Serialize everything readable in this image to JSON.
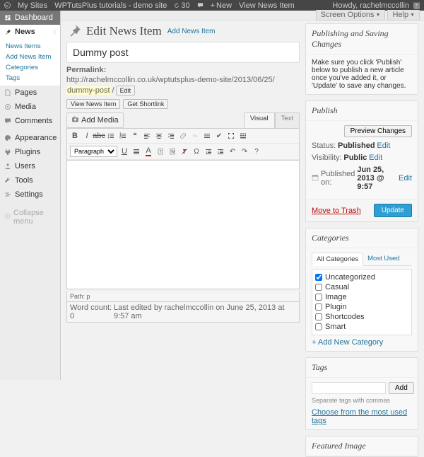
{
  "topbar": {
    "mysites": "My Sites",
    "sitename": "WPTutsPlus tutorials - demo site",
    "comments": "30",
    "new": "New",
    "view": "View News Item",
    "howdy": "Howdy, rachelmccollin"
  },
  "screenopts": {
    "screen": "Screen Options",
    "help": "Help"
  },
  "sidebar": {
    "dashboard": "Dashboard",
    "news": "News",
    "sub": {
      "items": "News Items",
      "add": "Add News Item",
      "cats": "Categories",
      "tags": "Tags"
    },
    "pages": "Pages",
    "media": "Media",
    "comments": "Comments",
    "appearance": "Appearance",
    "plugins": "Plugins",
    "users": "Users",
    "tools": "Tools",
    "settings": "Settings",
    "collapse": "Collapse menu"
  },
  "header": {
    "title": "Edit News Item",
    "add": "Add News Item"
  },
  "post": {
    "title": "Dummy post",
    "permalink_label": "Permalink:",
    "permalink_base": "http://rachelmccollin.co.uk/wptutsplus-demo-site/2013/06/25/",
    "permalink_slug": "dummy-post",
    "permalink_end": "/",
    "edit": "Edit",
    "view": "View News Item",
    "shortlink": "Get Shortlink",
    "addmedia": "Add Media",
    "visual": "Visual",
    "text": "Text",
    "paragraph": "Paragraph",
    "path": "Path: p",
    "wordcount": "Word count: 0",
    "lastedit": "Last edited by rachelmccollin on June 25, 2013 at 9:57 am"
  },
  "pubsave": {
    "title": "Publishing and Saving Changes",
    "msg": "Make sure you click 'Publish' below to publish a new article once you've added it, or 'Update' to save any changes."
  },
  "publish": {
    "title": "Publish",
    "preview": "Preview Changes",
    "status_l": "Status:",
    "status_v": "Published",
    "edit": "Edit",
    "vis_l": "Visibility:",
    "vis_v": "Public",
    "pub_l": "Published on:",
    "pub_v": "Jun 25, 2013 @ 9:57",
    "trash": "Move to Trash",
    "update": "Update"
  },
  "cats": {
    "title": "Categories",
    "all": "All Categories",
    "mostused": "Most Used",
    "items": [
      "Uncategorized",
      "Casual",
      "Image",
      "Plugin",
      "Shortcodes",
      "Smart"
    ],
    "addnew": "+ Add New Category"
  },
  "tags": {
    "title": "Tags",
    "add": "Add",
    "sep": "Separate tags with commas",
    "choose": "Choose from the most used tags"
  },
  "featured": {
    "title": "Featured Image"
  }
}
